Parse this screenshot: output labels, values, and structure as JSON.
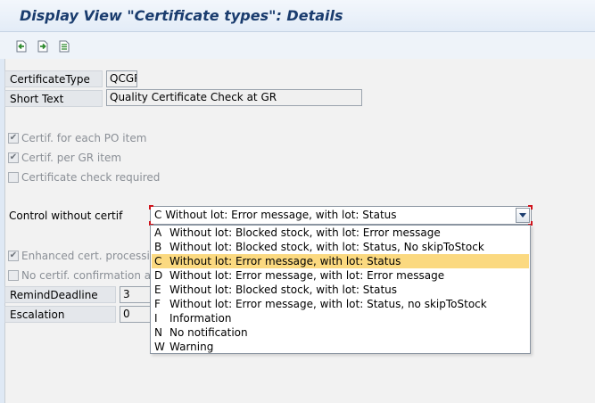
{
  "window": {
    "title": "Display View \"Certificate types\": Details"
  },
  "toolbar": {
    "icons": [
      "previous-entry-icon",
      "next-entry-icon",
      "other-entry-icon"
    ]
  },
  "form": {
    "certificate_type": {
      "label": "CertificateType",
      "value": "QCGR"
    },
    "short_text": {
      "label": "Short Text",
      "value": "Quality Certificate Check at GR"
    },
    "certif_each_po": {
      "label": "Certif. for each PO item",
      "checked": true
    },
    "certif_per_gr": {
      "label": "Certif. per GR item",
      "checked": true
    },
    "cert_check_required": {
      "label": "Certificate check required",
      "checked": false
    },
    "control_without_certif": {
      "label": "Control without certif",
      "value": "C Without lot: Error message, with lot: Status"
    },
    "enhanced_cert": {
      "label": "Enhanced cert. processing",
      "checked": true
    },
    "no_certif_confirmation": {
      "label": "No certif. confirmation at G",
      "checked": false
    },
    "remind_deadline": {
      "label": "RemindDeadline",
      "value": "3"
    },
    "escalation": {
      "label": "Escalation",
      "value": "0"
    }
  },
  "dropdown": {
    "selected_index": 2,
    "options": [
      {
        "key": "A",
        "text": "Without lot: Blocked stock, with lot: Error message"
      },
      {
        "key": "B",
        "text": "Without lot: Blocked stock, with lot: Status, No skipToStock"
      },
      {
        "key": "C",
        "text": "Without lot: Error message, with lot: Status"
      },
      {
        "key": "D",
        "text": "Without lot: Error message, with lot: Error message"
      },
      {
        "key": "E",
        "text": "Without lot: Blocked stock, with lot: Status"
      },
      {
        "key": "F",
        "text": "Without lot: Error message, with lot: Status, no skipToStock"
      },
      {
        "key": "I",
        "text": "Information"
      },
      {
        "key": "N",
        "text": "No notification"
      },
      {
        "key": "W",
        "text": "Warning"
      }
    ]
  },
  "colors": {
    "title": "#1a3c6e",
    "selected_row": "#fbd980",
    "focus_corner": "#d0141c"
  }
}
